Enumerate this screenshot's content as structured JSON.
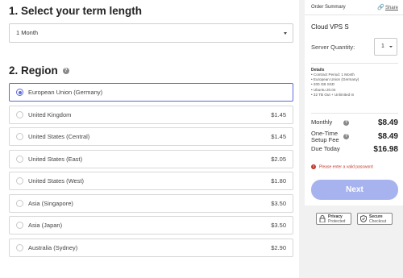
{
  "term": {
    "title": "1. Select your term length",
    "selected": "1 Month"
  },
  "region": {
    "title": "2. Region",
    "items": [
      {
        "name": "European Union (Germany)",
        "price": "",
        "selected": true
      },
      {
        "name": "United Kingdom",
        "price": "$1.45",
        "selected": false
      },
      {
        "name": "United States (Central)",
        "price": "$1.45",
        "selected": false
      },
      {
        "name": "United States (East)",
        "price": "$2.05",
        "selected": false
      },
      {
        "name": "United States (West)",
        "price": "$1.80",
        "selected": false
      },
      {
        "name": "Asia (Singapore)",
        "price": "$3.50",
        "selected": false
      },
      {
        "name": "Asia (Japan)",
        "price": "$3.50",
        "selected": false
      },
      {
        "name": "Australia (Sydney)",
        "price": "$2.90",
        "selected": false
      }
    ]
  },
  "summary": {
    "title": "Order Summary",
    "share": "Share",
    "product": "Cloud VPS S",
    "quantity_label": "Server Quantity:",
    "quantity_value": "1",
    "details_title": "Details",
    "details": [
      "Contract Period: 1 Month",
      "European Union (Germany)",
      "200 GB SSD",
      "Ubuntu 20.04",
      "32 TB Out + Unlimited In"
    ],
    "monthly_label": "Monthly",
    "monthly_value": "$8.49",
    "setup_label_1": "One-Time",
    "setup_label_2": "Setup Fee",
    "setup_value": "$8.49",
    "due_label": "Due Today",
    "due_value": "$16.98",
    "error": "Please enter a valid password",
    "next": "Next",
    "badges": [
      {
        "line1": "Privacy",
        "line2": "Protected",
        "icon": "lock-icon"
      },
      {
        "line1": "Secure",
        "line2": "Checkout",
        "icon": "shield-icon"
      }
    ]
  },
  "colors": {
    "accent": "#5b6dd8",
    "button": "#a7b3ee",
    "error": "#c0392b"
  }
}
